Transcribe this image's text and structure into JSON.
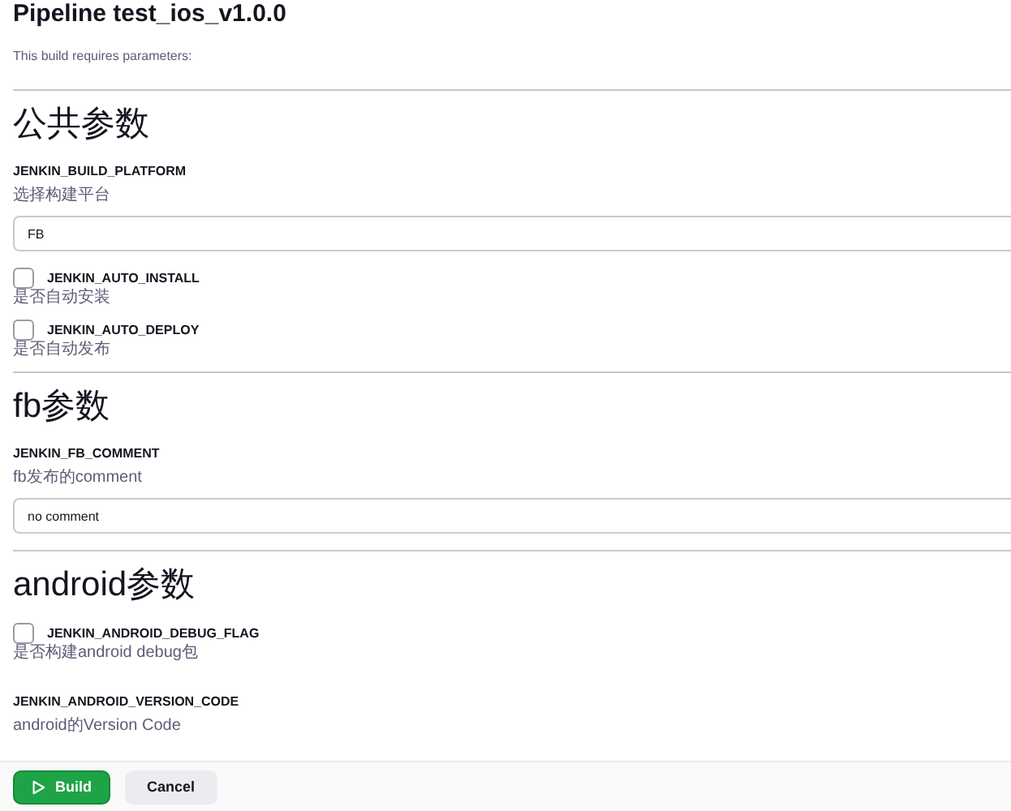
{
  "title": "Pipeline test_ios_v1.0.0",
  "intro": "This build requires parameters:",
  "sections": [
    {
      "heading": "公共参数",
      "params": [
        {
          "kind": "text",
          "name": "JENKIN_BUILD_PLATFORM",
          "description": "选择构建平台",
          "value": "FB"
        },
        {
          "kind": "checkbox",
          "name": "JENKIN_AUTO_INSTALL",
          "checked": false,
          "description": "是否自动安装"
        },
        {
          "kind": "checkbox",
          "name": "JENKIN_AUTO_DEPLOY",
          "checked": false,
          "description": "是否自动发布"
        }
      ]
    },
    {
      "heading": "fb参数",
      "params": [
        {
          "kind": "text",
          "name": "JENKIN_FB_COMMENT",
          "description": "fb发布的comment",
          "value": "no comment"
        }
      ]
    },
    {
      "heading": "android参数",
      "params": [
        {
          "kind": "checkbox",
          "name": "JENKIN_ANDROID_DEBUG_FLAG",
          "checked": false,
          "description": "是否构建android debug包"
        },
        {
          "kind": "label",
          "name": "JENKIN_ANDROID_VERSION_CODE",
          "description": "android的Version Code"
        }
      ]
    }
  ],
  "buttons": [
    {
      "kind": "primary",
      "label": "Build"
    },
    {
      "kind": "secondary",
      "label": "Cancel"
    }
  ]
}
